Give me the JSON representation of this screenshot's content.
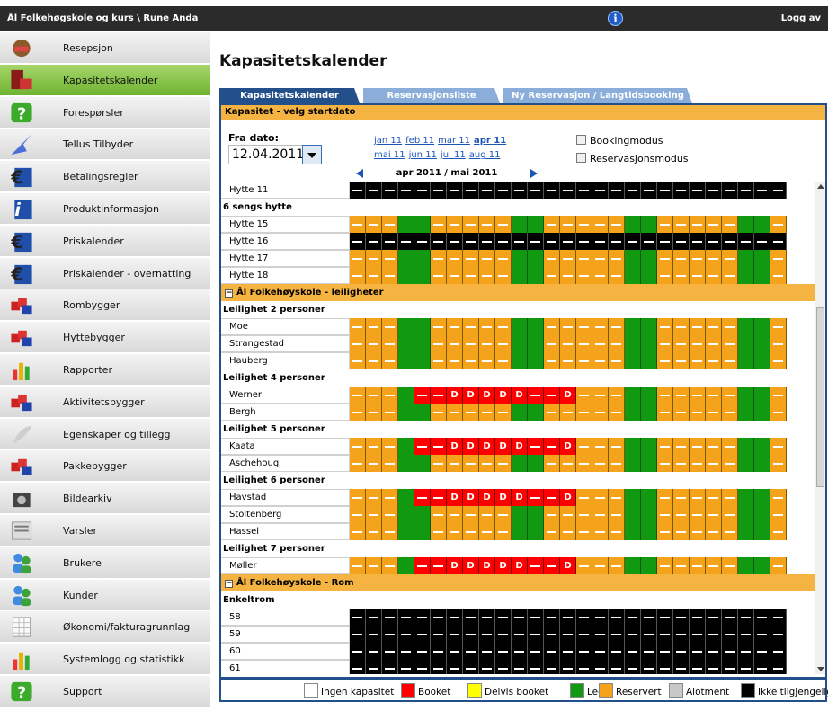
{
  "topbar": {
    "breadcrumb": "Ål Folkehøgskole og kurs \\ Rune Anda",
    "info": "i",
    "logout": "Logg av"
  },
  "sidebar": {
    "items": [
      {
        "label": "Resepsjon",
        "icon": "reception-icon"
      },
      {
        "label": "Kapasitetskalender",
        "icon": "calendar-icon",
        "active": true
      },
      {
        "label": "Forespørsler",
        "icon": "question-icon"
      },
      {
        "label": "Tellus Tilbyder",
        "icon": "arrow-icon"
      },
      {
        "label": "Betalingsregler",
        "icon": "euro-icon"
      },
      {
        "label": "Produktinformasjon",
        "icon": "info-icon"
      },
      {
        "label": "Priskalender",
        "icon": "euro-icon"
      },
      {
        "label": "Priskalender - overnatting",
        "icon": "euro-icon"
      },
      {
        "label": "Rombygger",
        "icon": "building-blocks-icon"
      },
      {
        "label": "Hyttebygger",
        "icon": "building-blocks-icon"
      },
      {
        "label": "Rapporter",
        "icon": "bar-chart-icon"
      },
      {
        "label": "Aktivitetsbygger",
        "icon": "building-blocks-icon"
      },
      {
        "label": "Egenskaper og tillegg",
        "icon": "feather-icon"
      },
      {
        "label": "Pakkebygger",
        "icon": "building-blocks-icon"
      },
      {
        "label": "Bildearkiv",
        "icon": "camera-icon"
      },
      {
        "label": "Varsler",
        "icon": "newspaper-icon"
      },
      {
        "label": "Brukere",
        "icon": "users-icon"
      },
      {
        "label": "Kunder",
        "icon": "users-icon"
      },
      {
        "label": "Økonomi/fakturagrunnlag",
        "icon": "spreadsheet-icon"
      },
      {
        "label": "Systemlogg og statistikk",
        "icon": "bar-chart-icon"
      },
      {
        "label": "Support",
        "icon": "question-icon"
      }
    ]
  },
  "main": {
    "title": "Kapasitetskalender",
    "tabs": [
      "Kapasitetskalender",
      "Reservasjonsliste",
      "Ny Reservasjon / Langtidsbooking"
    ],
    "header_strip": "Kapasitet - velg startdato",
    "date_label": "Fra dato:",
    "date_value": "12.04.2011",
    "months_row1": [
      "jan 11",
      "feb 11",
      "mar 11",
      "apr 11"
    ],
    "months_row2": [
      "mai 11",
      "jun 11",
      "jul 11",
      "aug 11"
    ],
    "current_month": "apr 11",
    "checkbox_booking": "Bookingmodus",
    "checkbox_reservation": "Reservasjonsmodus",
    "period": "apr 2011 / mai 2011"
  },
  "calendar": {
    "rows": [
      {
        "kind": "room",
        "name": "Hytte 11",
        "pattern": "X"
      },
      {
        "kind": "group",
        "name": "6 sengs hytte"
      },
      {
        "kind": "room",
        "name": "Hytte 15",
        "pattern": "A"
      },
      {
        "kind": "room",
        "name": "Hytte 16",
        "pattern": "X"
      },
      {
        "kind": "room",
        "name": "Hytte 17",
        "pattern": "A"
      },
      {
        "kind": "room",
        "name": "Hytte 18",
        "pattern": "A"
      },
      {
        "kind": "section",
        "name": "Ål Folkehøyskole - leiligheter"
      },
      {
        "kind": "group",
        "name": "Leilighet 2 personer"
      },
      {
        "kind": "room",
        "name": "Moe",
        "pattern": "C"
      },
      {
        "kind": "room",
        "name": "Strangestad",
        "pattern": "C"
      },
      {
        "kind": "room",
        "name": "Hauberg",
        "pattern": "C"
      },
      {
        "kind": "group",
        "name": "Leilighet 4 personer"
      },
      {
        "kind": "room",
        "name": "Werner",
        "pattern": "D"
      },
      {
        "kind": "room",
        "name": "Bergh",
        "pattern": "A"
      },
      {
        "kind": "group",
        "name": "Leilighet 5 personer"
      },
      {
        "kind": "room",
        "name": "Kaata",
        "pattern": "D"
      },
      {
        "kind": "room",
        "name": "Aschehoug",
        "pattern": "A"
      },
      {
        "kind": "group",
        "name": "Leilighet 6 personer"
      },
      {
        "kind": "room",
        "name": "Havstad",
        "pattern": "D"
      },
      {
        "kind": "room",
        "name": "Stoltenberg",
        "pattern": "A"
      },
      {
        "kind": "room",
        "name": "Hassel",
        "pattern": "A"
      },
      {
        "kind": "group",
        "name": "Leilighet 7 personer"
      },
      {
        "kind": "room",
        "name": "Møller",
        "pattern": "D"
      },
      {
        "kind": "section",
        "name": "Ål Folkehøyskole - Rom"
      },
      {
        "kind": "group",
        "name": "Enkeltrom"
      },
      {
        "kind": "room",
        "name": "58",
        "pattern": "X"
      },
      {
        "kind": "room",
        "name": "59",
        "pattern": "X"
      },
      {
        "kind": "room",
        "name": "60",
        "pattern": "X"
      },
      {
        "kind": "room",
        "name": "61",
        "pattern": "X"
      }
    ],
    "patterns": {
      "A": "RRRLLRRRRRLLRRRRRLLRRRRRLLR",
      "C": "RRRLLRRRRRLLRRRRRLLRRRRRLLR",
      "D": "RRRLBBDDDDDBBDRRRLLRRRRRLLR",
      "X": "XXXXXXXXXXXXXXXXXXXXXXXXXXX"
    },
    "booked_letter": "D"
  },
  "legend": [
    {
      "label": "Ingen kapasitet",
      "color": "#ffffff"
    },
    {
      "label": "Booket",
      "color": "#ff0000"
    },
    {
      "label": "Delvis booket",
      "color": "#ffff00"
    },
    {
      "label": "Ledig",
      "color": "#119911"
    },
    {
      "label": "Reservert",
      "color": "#f5a31a"
    },
    {
      "label": "Alotment",
      "color": "#c8c8c8"
    },
    {
      "label": "Ikke tilgjengelig",
      "color": "#000000"
    }
  ]
}
